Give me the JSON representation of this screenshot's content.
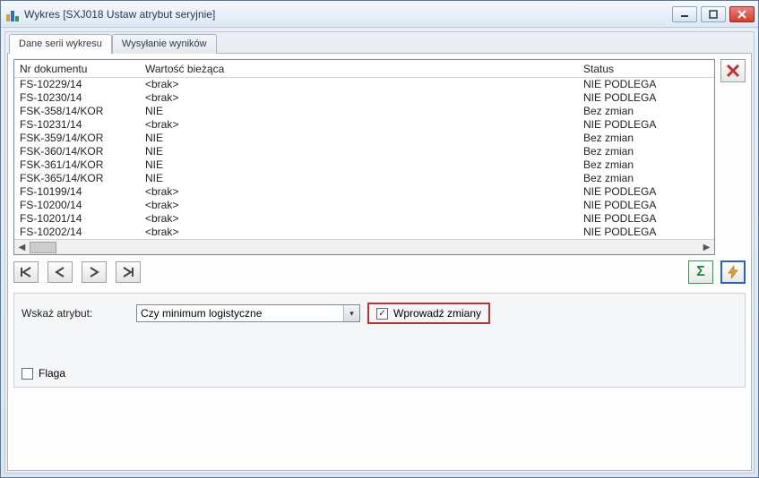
{
  "window": {
    "title": "Wykres [SXJ018 Ustaw atrybut seryjnie]"
  },
  "tabs": [
    {
      "label": "Dane serii wykresu",
      "active": true
    },
    {
      "label": "Wysyłanie wyników",
      "active": false
    }
  ],
  "grid": {
    "headers": {
      "doc": "Nr dokumentu",
      "val": "Wartość bieżąca",
      "status": "Status"
    },
    "rows": [
      {
        "doc": "FS-10229/14",
        "val": "<brak>",
        "status": "NIE PODLEGA"
      },
      {
        "doc": "FS-10230/14",
        "val": "<brak>",
        "status": "NIE PODLEGA"
      },
      {
        "doc": "FSK-358/14/KOR",
        "val": "NIE",
        "status": "Bez zmian"
      },
      {
        "doc": "FS-10231/14",
        "val": "<brak>",
        "status": "NIE PODLEGA"
      },
      {
        "doc": "FSK-359/14/KOR",
        "val": "NIE",
        "status": "Bez zmian"
      },
      {
        "doc": "FSK-360/14/KOR",
        "val": "NIE",
        "status": "Bez zmian"
      },
      {
        "doc": "FSK-361/14/KOR",
        "val": "NIE",
        "status": "Bez zmian"
      },
      {
        "doc": "FSK-365/14/KOR",
        "val": "NIE",
        "status": "Bez zmian"
      },
      {
        "doc": "FS-10199/14",
        "val": "<brak>",
        "status": "NIE PODLEGA"
      },
      {
        "doc": "FS-10200/14",
        "val": "<brak>",
        "status": "NIE PODLEGA"
      },
      {
        "doc": "FS-10201/14",
        "val": "<brak>",
        "status": "NIE PODLEGA"
      },
      {
        "doc": "FS-10202/14",
        "val": "<brak>",
        "status": "NIE PODLEGA"
      }
    ]
  },
  "bottom": {
    "attr_label": "Wskaż atrybut:",
    "attr_value": "Czy minimum logistyczne",
    "apply_label": "Wprowadź zmiany",
    "apply_checked": true,
    "flag_label": "Flaga",
    "flag_checked": false
  }
}
